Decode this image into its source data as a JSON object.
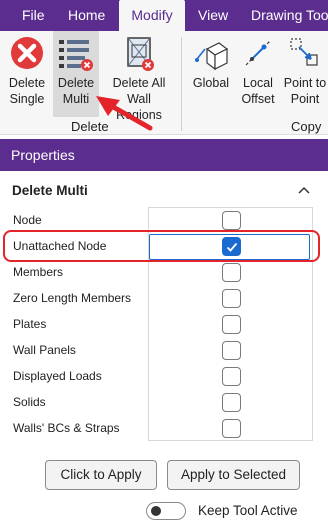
{
  "menu": {
    "tabs": [
      {
        "label": "File"
      },
      {
        "label": "Home"
      },
      {
        "label": "Modify",
        "active": true
      },
      {
        "label": "View"
      },
      {
        "label": "Drawing Too"
      }
    ]
  },
  "ribbon": {
    "buttons": [
      {
        "label_line1": "Delete",
        "label_line2": "Single",
        "icon": "delete-circle-icon"
      },
      {
        "label_line1": "Delete",
        "label_line2": "Multi",
        "icon": "delete-multi-icon",
        "hovered": true
      },
      {
        "label_line1": "Delete All",
        "label_line2": "Wall Regions",
        "icon": "delete-wall-regions-icon"
      },
      {
        "label_line1": "Global",
        "label_line2": "",
        "icon": "global-axes-icon"
      },
      {
        "label_line1": "Local",
        "label_line2": "Offset",
        "icon": "local-offset-icon"
      },
      {
        "label_line1": "Point to",
        "label_line2": "Point",
        "icon": "point-to-point-icon"
      }
    ],
    "groups": {
      "delete": "Delete",
      "copy": "Copy"
    }
  },
  "properties": {
    "header": "Properties",
    "section_title": "Delete Multi",
    "rows": [
      {
        "label": "Node",
        "checked": false
      },
      {
        "label": "Unattached Node",
        "checked": true,
        "highlighted": true
      },
      {
        "label": "Members",
        "checked": false
      },
      {
        "label": "Zero Length Members",
        "checked": false
      },
      {
        "label": "Plates",
        "checked": false
      },
      {
        "label": "Wall Panels",
        "checked": false
      },
      {
        "label": "Displayed Loads",
        "checked": false
      },
      {
        "label": "Solids",
        "checked": false
      },
      {
        "label": "Walls' BCs & Straps",
        "checked": false
      }
    ],
    "buttons": {
      "apply": "Click to Apply",
      "apply_selected": "Apply to Selected"
    },
    "keep_tool_active": {
      "label": "Keep Tool Active",
      "on": false
    }
  },
  "colors": {
    "accent": "#5b2d8e",
    "check": "#1a6ad1",
    "highlight": "#e3242b"
  }
}
